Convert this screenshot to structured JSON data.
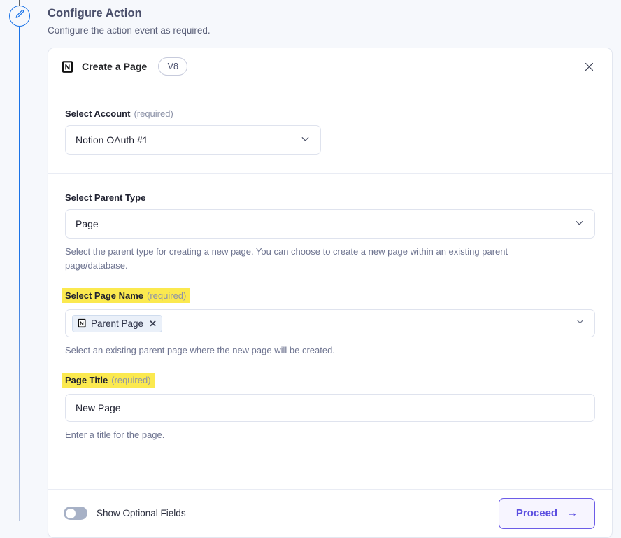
{
  "page": {
    "title": "Configure Action",
    "subtitle": "Configure the action event as required.",
    "node_icon": "pencil-icon"
  },
  "card": {
    "app_icon": "notion-icon",
    "title": "Create a Page",
    "version_badge": "V8",
    "close_icon": "close-icon"
  },
  "account": {
    "label": "Select Account",
    "required_text": "(required)",
    "selected_value": "Notion OAuth #1",
    "chevron_icon": "chevron-down-icon"
  },
  "parent_type": {
    "label": "Select Parent Type",
    "selected_value": "Page",
    "help": "Select the parent type for creating a new page. You can choose to create a new page within an existing parent page/database.",
    "chevron_icon": "chevron-down-icon"
  },
  "page_name": {
    "label": "Select Page Name",
    "required_text": "(required)",
    "highlighted": true,
    "chip_label": "Parent Page",
    "chip_icon": "notion-icon",
    "chip_remove_icon": "x-icon",
    "help": "Select an existing parent page where the new page will be created.",
    "chevron_icon": "chevron-down-icon"
  },
  "page_title": {
    "label": "Page Title",
    "required_text": "(required)",
    "highlighted": true,
    "value": "New Page",
    "placeholder": "New Page",
    "help": "Enter a title for the page."
  },
  "footer": {
    "toggle_label": "Show Optional Fields",
    "toggle_state": "off",
    "proceed_label": "Proceed",
    "proceed_arrow": "→"
  },
  "colors": {
    "page_background": "#f6f8fc",
    "card_background": "#ffffff",
    "accent_purple": "#6c5ce7",
    "connector_blue": "#1a73e8",
    "highlight_yellow": "#fbe94f",
    "border": "#dfe3ee",
    "muted_text": "#6e7490"
  }
}
